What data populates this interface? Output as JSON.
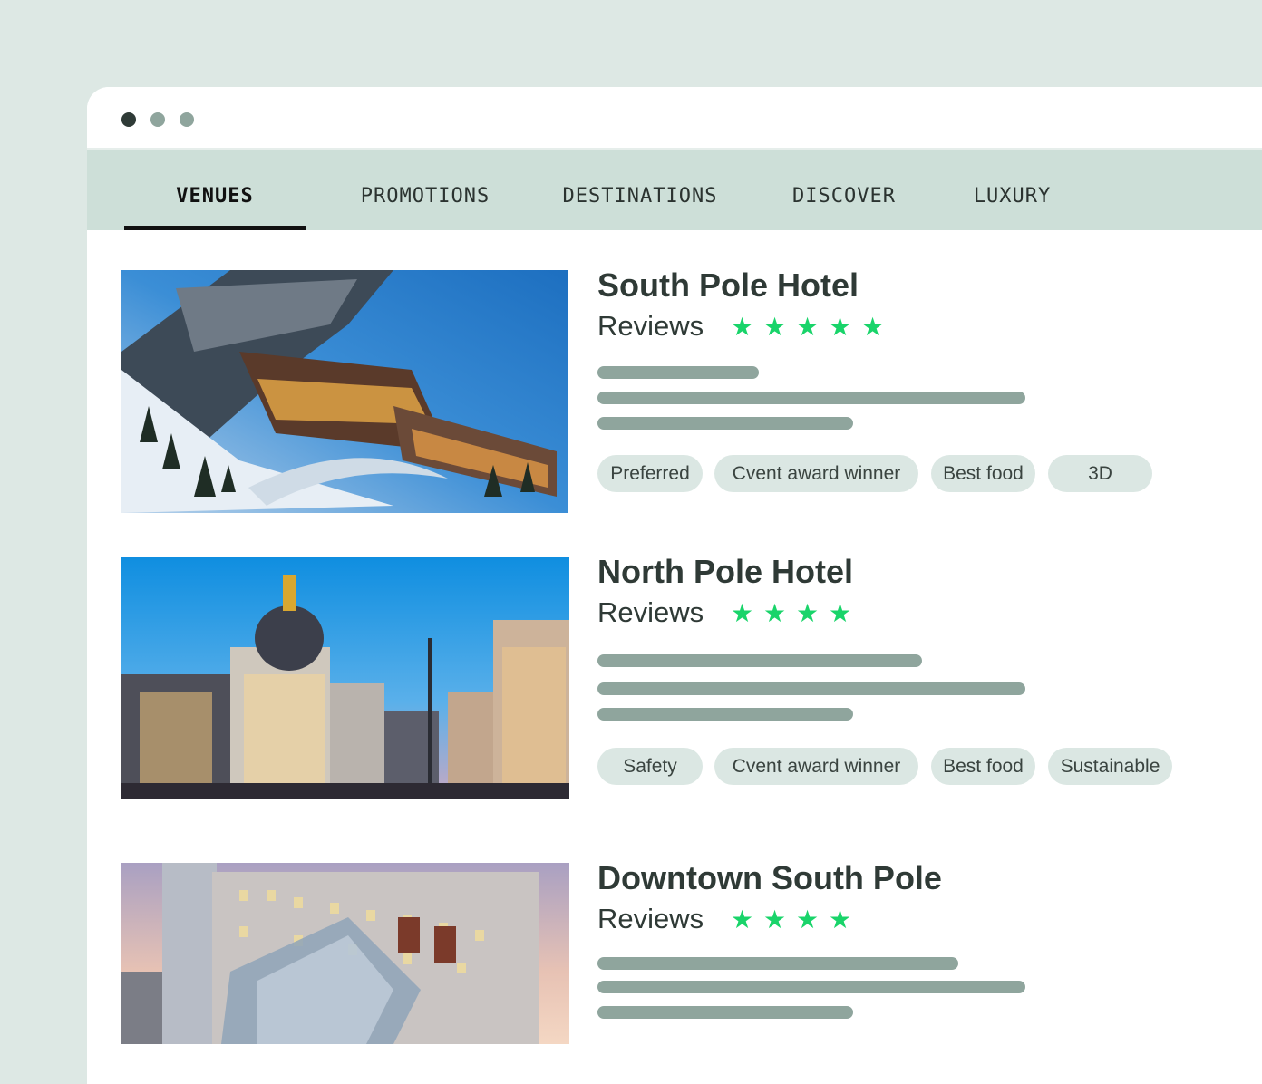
{
  "window_controls": {
    "colors": [
      "#2f3b37",
      "#8fa59d",
      "#8fa59d"
    ]
  },
  "tabs": [
    {
      "label": "VENUES",
      "active": true
    },
    {
      "label": "PROMOTIONS",
      "active": false
    },
    {
      "label": "DESTINATIONS",
      "active": false
    },
    {
      "label": "DISCOVER",
      "active": false
    },
    {
      "label": "LUXURY",
      "active": false
    }
  ],
  "colors": {
    "page_bg": "#dde8e4",
    "tab_bar_bg": "#cddfd8",
    "star": "#19d46a",
    "placeholder_bar": "#8fa59d",
    "chip_bg": "#dbe7e3",
    "text_dark": "#2f3a36"
  },
  "venues": [
    {
      "name": "South Pole Hotel",
      "reviews_label": "Reviews",
      "rating": 5,
      "image": "snowy-mountain-resort-photo",
      "tags": [
        "Preferred",
        "Cvent award winner",
        "Best food",
        "3D"
      ]
    },
    {
      "name": "North Pole Hotel",
      "reviews_label": "Reviews",
      "rating": 4,
      "image": "city-street-dusk-photo",
      "tags": [
        "Safety",
        "Cvent award winner",
        "Best food",
        "Sustainable"
      ]
    },
    {
      "name": "Downtown South Pole",
      "reviews_label": "Reviews",
      "rating": 4,
      "image": "modern-hotel-building-photo",
      "tags": []
    }
  ]
}
